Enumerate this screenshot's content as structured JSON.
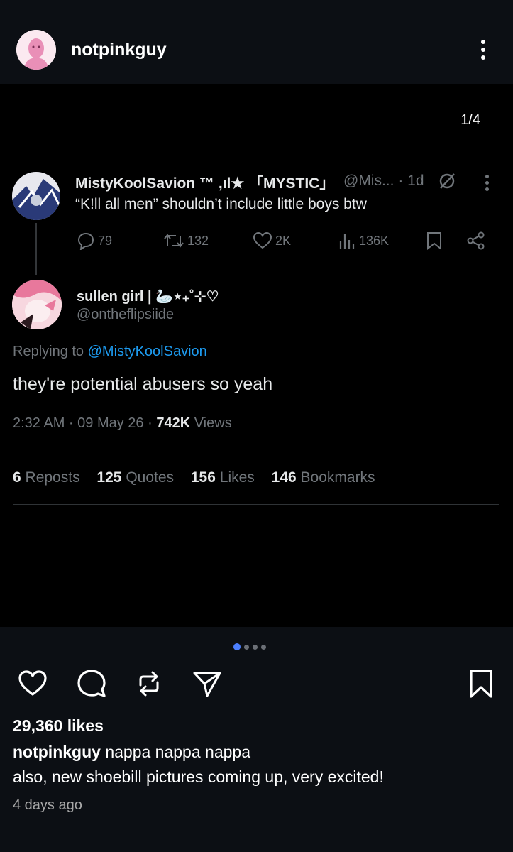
{
  "header": {
    "username": "notpinkguy"
  },
  "post": {
    "counter": "1/4",
    "tweet": {
      "name": "MistyKoolSavion ™ ,ıl★ 「MYSTIC」",
      "handle_time": "@Mis... · 1d",
      "text": "“K!ll all men” shouldn’t include little boys btw",
      "replies": "79",
      "reposts": "132",
      "likes": "2K",
      "views": "136K"
    },
    "reply": {
      "name": "sullen girl | 🦢⋆₊˚⊹♡",
      "handle": "@ontheflipsiide",
      "replying_prefix": "Replying to",
      "replying_mention": "@MistyKoolSavion",
      "text": "they're potential abusers so yeah",
      "time": "2:32 AM · 09 May 26 ·",
      "views_count": "742K",
      "views_label": "Views",
      "stats": [
        {
          "count": "6",
          "label": "Reposts"
        },
        {
          "count": "125",
          "label": "Quotes"
        },
        {
          "count": "156",
          "label": "Likes"
        },
        {
          "count": "146",
          "label": "Bookmarks"
        }
      ]
    }
  },
  "footer": {
    "likes": "29,360 likes",
    "caption_user": "notpinkguy",
    "caption_text": "nappa nappa nappa",
    "caption_line2": "also, new shoebill pictures coming up, very excited!",
    "time_ago": "4 days ago",
    "carousel_total": 4,
    "carousel_active": 1
  },
  "colors": {
    "accent": "#4c7fff",
    "mention": "#1d9bf0",
    "muted": "#71767b"
  }
}
